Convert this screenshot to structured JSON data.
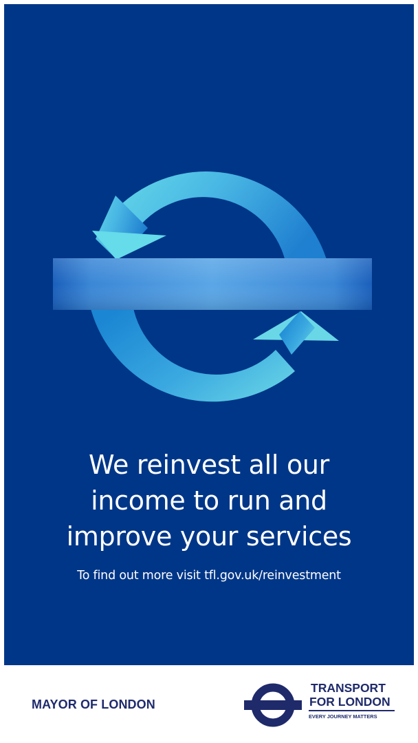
{
  "headline": {
    "line1": "We reinvest all our",
    "line2": "income to run and",
    "line3": "improve your services"
  },
  "subline": "To find out more visit tfl.gov.uk/reinvestment",
  "footer": {
    "mayor_label": "MAYOR OF LONDON",
    "tfl_line1": "TRANSPORT",
    "tfl_line2": "FOR LONDON",
    "tfl_tagline": "EVERY JOURNEY MATTERS"
  },
  "icons": {
    "emblem": "circular-arrows-roundel-icon",
    "logo": "tfl-roundel-icon"
  },
  "colors": {
    "panel_background": "#003688",
    "text_dark": "#1f2a6b",
    "arrow_light": "#5fd0e8",
    "arrow_dark": "#1c86d0"
  }
}
